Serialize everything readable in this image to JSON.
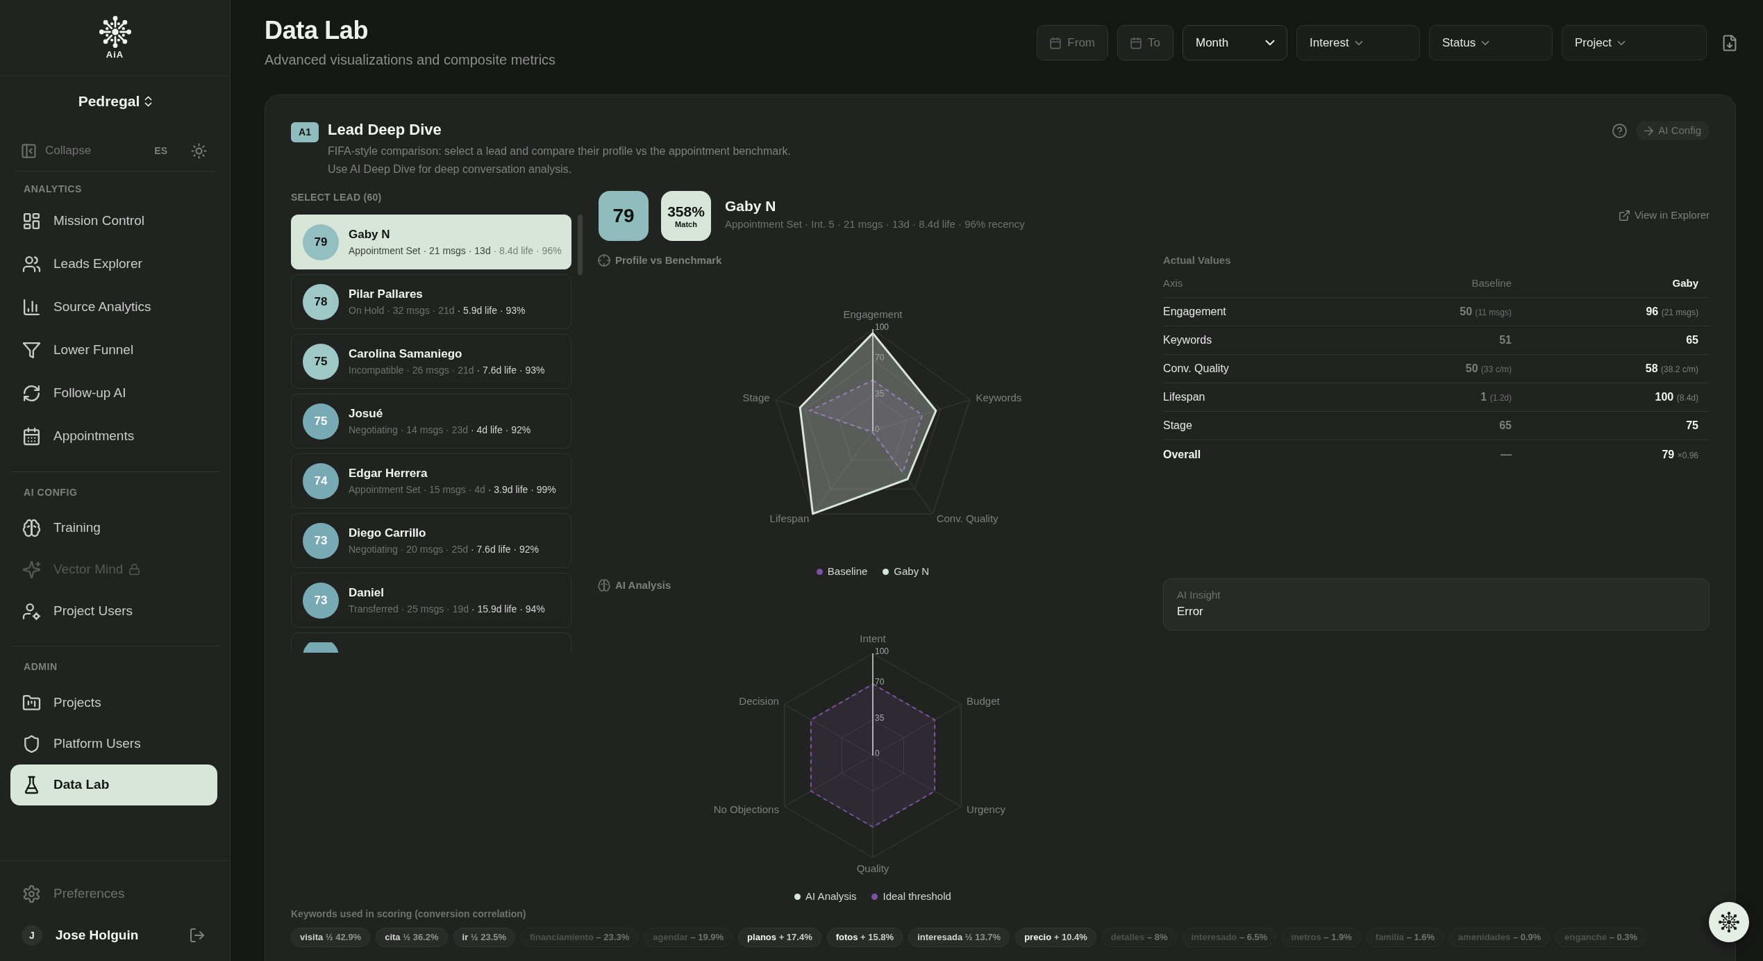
{
  "sidebar": {
    "logo": {
      "text": "AiA"
    },
    "workspace": "Pedregal",
    "collapse_label": "Collapse",
    "language": "ES",
    "sections": [
      {
        "title": "ANALYTICS",
        "items": [
          {
            "label": "Mission Control",
            "selected": false,
            "disabled": false
          },
          {
            "label": "Leads Explorer",
            "selected": false,
            "disabled": false
          },
          {
            "label": "Source Analytics",
            "selected": false,
            "disabled": false
          },
          {
            "label": "Lower Funnel",
            "selected": false,
            "disabled": false
          },
          {
            "label": "Follow-up AI",
            "selected": false,
            "disabled": false
          },
          {
            "label": "Appointments",
            "selected": false,
            "disabled": false
          }
        ]
      },
      {
        "title": "AI CONFIG",
        "items": [
          {
            "label": "Training",
            "selected": false,
            "disabled": false
          },
          {
            "label": "Vector Mind",
            "selected": false,
            "disabled": true
          },
          {
            "label": "Project Users",
            "selected": false,
            "disabled": false
          }
        ]
      },
      {
        "title": "ADMIN",
        "items": [
          {
            "label": "Projects",
            "selected": false,
            "disabled": false
          },
          {
            "label": "Platform Users",
            "selected": false,
            "disabled": false
          },
          {
            "label": "Data Lab",
            "selected": true,
            "disabled": false
          }
        ]
      }
    ],
    "footer": {
      "preferences": "Preferences",
      "user": {
        "initial": "J",
        "name": "Jose Holguin"
      }
    }
  },
  "header": {
    "title": "Data Lab",
    "subtitle": "Advanced visualizations and composite metrics",
    "filters": [
      {
        "kind": "date",
        "label": "From"
      },
      {
        "kind": "date",
        "label": "To"
      },
      {
        "kind": "select",
        "value": "Month"
      },
      {
        "kind": "dropdown",
        "label": "Interest"
      },
      {
        "kind": "dropdown",
        "label": "Status"
      },
      {
        "kind": "dropdown",
        "label": "Project"
      }
    ]
  },
  "panel": {
    "badge": "A1",
    "title": "Lead Deep Dive",
    "description": [
      "FIFA-style comparison: select a lead and compare their profile vs the appointment benchmark.",
      "Use AI Deep Dive for deep conversation analysis."
    ],
    "config_button": "AI Config",
    "lead_picker": {
      "title": "SELECT LEAD (60)",
      "leads": [
        {
          "kind": "lead",
          "score": "79",
          "name": "Gaby N",
          "meta": "Appointment Set · 21 msgs · 13d",
          "stats": "· 8.4d life · 96%",
          "color": "#93bfc0",
          "selected": true
        },
        {
          "kind": "lead",
          "score": "78",
          "name": "Pilar Pallares",
          "meta": "On Hold · 32 msgs · 21d",
          "stats": "· 5.9d life · 93%",
          "color": "#9ec8c5",
          "selected": false
        },
        {
          "kind": "lead",
          "score": "75",
          "name": "Carolina Samaniego",
          "meta": "Incompatible · 26 msgs · 21d",
          "stats": "· 7.6d life · 93%",
          "color": "#9ec8c5",
          "selected": false
        },
        {
          "kind": "lead",
          "score": "75",
          "name": "Josué",
          "meta": "Negotiating · 14 msgs · 23d",
          "stats": "· 4d life · 92%",
          "color": "#78aab6",
          "selected": false
        },
        {
          "kind": "lead",
          "score": "74",
          "name": "Edgar Herrera",
          "meta": "Appointment Set · 15 msgs · 4d",
          "stats": "· 3.9d life · 99%",
          "color": "#78aab6",
          "selected": false
        },
        {
          "kind": "lead",
          "score": "73",
          "name": "Diego Carrillo",
          "meta": "Negotiating · 20 msgs · 25d",
          "stats": "· 7.6d life · 92%",
          "color": "#78aab6",
          "selected": false
        },
        {
          "kind": "lead",
          "score": "73",
          "name": "Daniel",
          "meta": "Transferred · 25 msgs · 19d",
          "stats": "· 15.9d life · 94%",
          "color": "#78aab6",
          "selected": false
        },
        {
          "kind": "partial",
          "color": "#78aab6",
          "selected": false
        }
      ]
    },
    "profile": {
      "score": "79",
      "match": "358%",
      "match_label": "Match",
      "name": "Gaby N",
      "summary": "Appointment Set · Int. 5 · 21 msgs · 13d · 8.4d life · 96% recency",
      "link": "View in Explorer"
    },
    "benchmark": {
      "title": "Profile vs Benchmark",
      "chart_data": {
        "type": "radar",
        "categories": [
          "Engagement",
          "Keywords",
          "Conv. Quality",
          "Lifespan",
          "Stage"
        ],
        "ylim": [
          0,
          100
        ],
        "yticks": [
          0,
          35,
          70,
          100
        ],
        "legend": "bottom",
        "series": [
          {
            "name": "Baseline",
            "color": "#7d52a3",
            "values": [
              50,
              51,
              50,
              1,
              65
            ]
          },
          {
            "name": "Gaby N",
            "color": "#d7e6d9",
            "values": [
              96,
              65,
              58,
              100,
              75
            ]
          }
        ]
      }
    },
    "ai_analysis": {
      "title": "AI Analysis",
      "axes": [
        "Intent",
        "Budget",
        "Urgency",
        "Quality",
        "No Objections",
        "Decision"
      ],
      "ticks": [
        "100",
        "70",
        "35",
        "0"
      ],
      "legend": [
        {
          "kind": "series",
          "name": "AI Analysis",
          "color": "#d7e6d9"
        },
        {
          "kind": "threshold",
          "name": "Ideal threshold",
          "color": "#7d52a3"
        }
      ]
    },
    "actual_values": {
      "title": "Actual Values",
      "columns": [
        "Axis",
        "Baseline",
        "Gaby"
      ],
      "rows": [
        {
          "kind": "axis",
          "axis": "Engagement",
          "baseline": "50 (11 msgs)",
          "lead": "96 (21 msgs)"
        },
        {
          "kind": "axis",
          "axis": "Keywords",
          "baseline": "51",
          "lead": "65"
        },
        {
          "kind": "axis",
          "axis": "Conv. Quality",
          "baseline": "50 (33 c/m)",
          "lead": "58 (38.2 c/m)"
        },
        {
          "kind": "axis",
          "axis": "Lifespan",
          "baseline": "1 (1.2d)",
          "lead": "100 (8.4d)"
        },
        {
          "kind": "axis",
          "axis": "Stage",
          "baseline": "65",
          "lead": "75"
        },
        {
          "kind": "total",
          "axis": "Overall",
          "baseline": "—",
          "lead": "79 ×0.96"
        }
      ]
    },
    "ai_insight": {
      "title": "AI Insight",
      "text": "Error"
    },
    "keywords": {
      "title": "Keywords used in scoring (conversion correlation)",
      "chips": [
        {
          "kind": "strong",
          "word": "visita",
          "value": "½ 42.9%"
        },
        {
          "kind": "strong",
          "word": "cita",
          "value": "½ 36.2%"
        },
        {
          "kind": "strong",
          "word": "ir",
          "value": "½ 23.5%"
        },
        {
          "kind": "weak",
          "word": "financiamiento",
          "value": "– 23.3%"
        },
        {
          "kind": "weak",
          "word": "agendar",
          "value": "– 19.9%"
        },
        {
          "kind": "positive",
          "word": "planos",
          "value": "+ 17.4%"
        },
        {
          "kind": "positive",
          "word": "fotos",
          "value": "+ 15.8%"
        },
        {
          "kind": "strong",
          "word": "interesada",
          "value": "½ 13.7%"
        },
        {
          "kind": "positive",
          "word": "precio",
          "value": "+ 10.4%"
        },
        {
          "kind": "weak",
          "word": "detalles",
          "value": "– 8%"
        },
        {
          "kind": "weak",
          "word": "interesado",
          "value": "– 6.5%"
        },
        {
          "kind": "weak",
          "word": "metros",
          "value": "– 1.9%"
        },
        {
          "kind": "weak",
          "word": "familia",
          "value": "– 1.6%"
        },
        {
          "kind": "weak",
          "word": "amenidades",
          "value": "– 0.9%"
        },
        {
          "kind": "weak",
          "word": "enganche",
          "value": "– 0.3%"
        }
      ]
    }
  }
}
